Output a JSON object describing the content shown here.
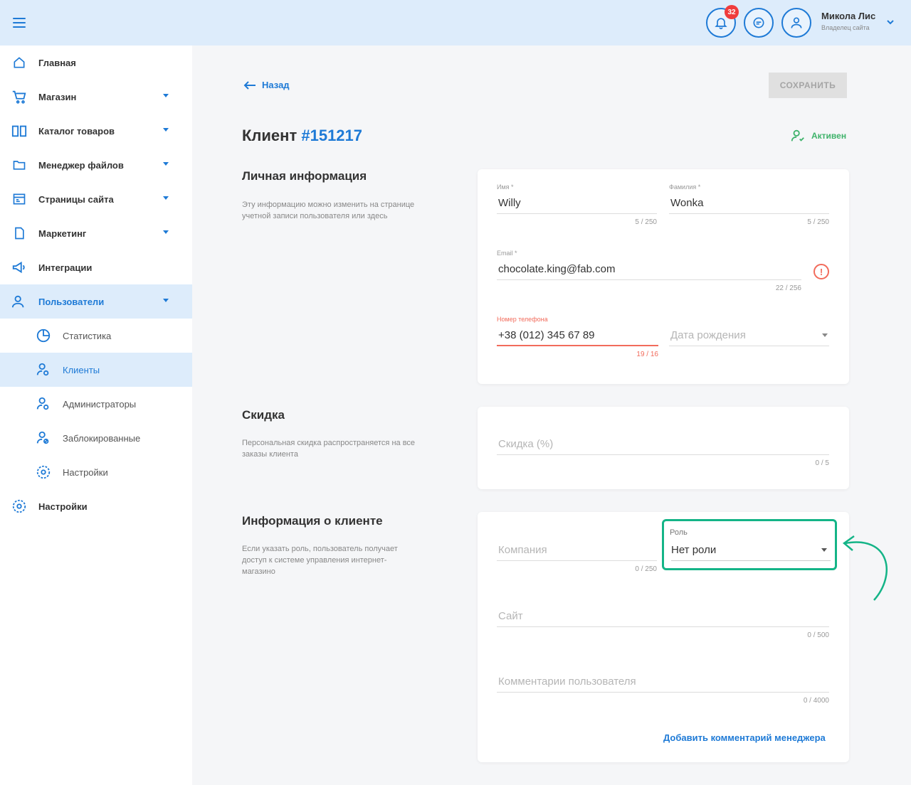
{
  "header": {
    "notifications_count": "32",
    "user_name": "Микола Лис",
    "user_role": "Владелец сайта"
  },
  "sidebar": {
    "items": [
      {
        "label": "Главная",
        "icon": "home-icon"
      },
      {
        "label": "Магазин",
        "icon": "cart-icon"
      },
      {
        "label": "Каталог товаров",
        "icon": "book-icon"
      },
      {
        "label": "Менеджер файлов",
        "icon": "folder-icon"
      },
      {
        "label": "Страницы сайта",
        "icon": "pages-icon"
      },
      {
        "label": "Маркетинг",
        "icon": "marketing-icon"
      },
      {
        "label": "Интеграции",
        "icon": "megaphone-icon"
      },
      {
        "label": "Пользователи",
        "icon": "users-icon"
      }
    ],
    "sub_items": [
      {
        "label": "Статистика",
        "icon": "chart-icon"
      },
      {
        "label": "Клиенты",
        "icon": "clients-icon"
      },
      {
        "label": "Администраторы",
        "icon": "admin-icon"
      },
      {
        "label": "Заблокированные",
        "icon": "blocked-icon"
      },
      {
        "label": "Настройки",
        "icon": "gear-icon"
      }
    ],
    "bottom": {
      "label": "Настройки",
      "icon": "gear-icon"
    }
  },
  "main": {
    "back_label": "Назад",
    "save_label": "СОХРАНИТЬ",
    "title_prefix": "Клиент",
    "title_number": "#151217",
    "status_label": "Активен",
    "personal": {
      "title": "Личная информация",
      "desc": "Эту информацию можно изменить на странице учетной записи пользователя или здесь",
      "first_name_label": "Имя *",
      "first_name_value": "Willy",
      "first_name_count": "5 / 250",
      "last_name_label": "Фамилия *",
      "last_name_value": "Wonka",
      "last_name_count": "5 / 250",
      "email_label": "Email *",
      "email_value": "chocolate.king@fab.com",
      "email_count": "22 / 256",
      "phone_label": "Номер телефона",
      "phone_value": "+38 (012) 345 67 89",
      "phone_count": "19 / 16",
      "birth_placeholder": "Дата рождения"
    },
    "discount": {
      "title": "Скидка",
      "desc": "Персональная скидка распространяется на все заказы клиента",
      "placeholder": "Скидка (%)",
      "count": "0 / 5"
    },
    "client_info": {
      "title": "Информация о клиенте",
      "desc": "Если указать роль, пользователь получает доступ к системе управления интернет-магазино",
      "company_placeholder": "Компания",
      "company_count": "0 / 250",
      "role_label": "Роль",
      "role_value": "Нет роли",
      "site_placeholder": "Сайт",
      "site_count": "0 / 500",
      "comment_placeholder": "Комментарии пользователя",
      "comment_count": "0 / 4000",
      "manager_link": "Добавить комментарий менеджера"
    }
  },
  "colors": {
    "accent": "#1e7ad6",
    "header_bg": "#ddecfb",
    "highlight": "#14b487",
    "error": "#f26b5b",
    "success": "#3fb36b"
  }
}
